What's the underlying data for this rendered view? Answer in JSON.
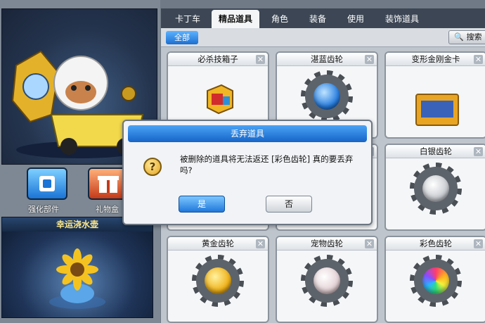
{
  "tabs": [
    {
      "label": "卡丁车"
    },
    {
      "label": "精品道具"
    },
    {
      "label": "角色"
    },
    {
      "label": "装备"
    },
    {
      "label": "使用"
    },
    {
      "label": "装饰道具"
    }
  ],
  "filter": {
    "all_label": "全部",
    "search_label": "搜索"
  },
  "left": {
    "enhance_label": "强化部件",
    "gift_label": "礼物盒",
    "lucky_title": "幸运浇水壶"
  },
  "items": [
    {
      "name": "必杀技箱子"
    },
    {
      "name": "湛蓝齿轮"
    },
    {
      "name": "变形金刚金卡"
    },
    {
      "name": ""
    },
    {
      "name": ""
    },
    {
      "name": "白银齿轮"
    },
    {
      "name": "黄金齿轮"
    },
    {
      "name": "宠物齿轮"
    },
    {
      "name": "彩色齿轮"
    }
  ],
  "dialog": {
    "title": "丢弃道具",
    "message": "被删除的道具将无法返还 [彩色齿轮] 真的要丢弃吗?",
    "confirm_label": "是",
    "cancel_label": "否"
  },
  "colors": {
    "accent": "#1c6fd0",
    "tab_bar": "#3c4654"
  }
}
